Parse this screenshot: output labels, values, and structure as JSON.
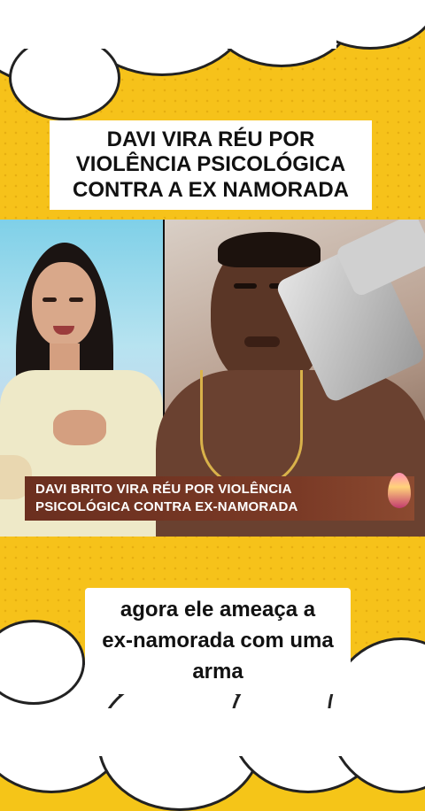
{
  "headline": {
    "lines": [
      "DAVI VIRA RÉU POR",
      "VIOLÊNCIA PSICOLÓGICA",
      "CONTRA A EX NAMORADA"
    ]
  },
  "video": {
    "lower_third": {
      "line1": "DAVI BRITO VIRA RÉU POR VIOLÊNCIA",
      "line2": "PSICOLÓGICA CONTRA EX-NAMORADA"
    }
  },
  "subtitle": {
    "lines": [
      "agora ele ameaça a",
      "ex-namorada com uma",
      "arma"
    ]
  },
  "colors": {
    "background": "#f6c21a",
    "lower_third": "#6b2f1f",
    "caption_bg": "#ffffff",
    "caption_text": "#111111"
  }
}
